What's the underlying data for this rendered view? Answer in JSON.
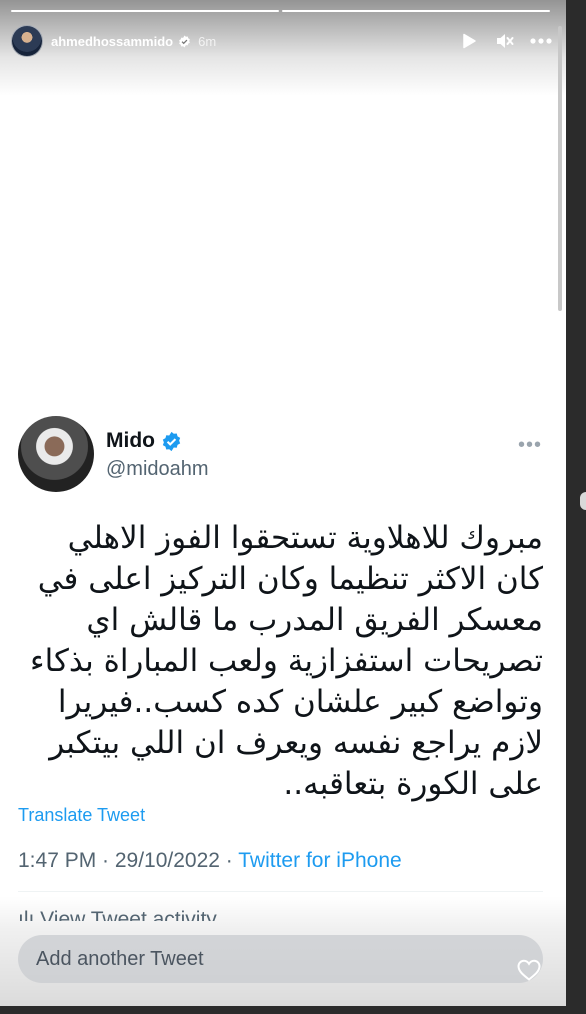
{
  "story": {
    "username": "ahmedhossammido",
    "time": "6m",
    "progress": [
      1.0,
      1.0
    ]
  },
  "tweet": {
    "name": "Mido",
    "handle": "@midoahm",
    "text": "مبروك للاهلاوية تستحقوا الفوز الاهلي كان الاكثر تنظيما وكان التركيز اعلى في معسكر الفريق المدرب ما قالش اي تصريحات استفزازية ولعب المباراة بذكاء وتواضع كبير علشان كده كسب..فيريرا لازم يراجع نفسه ويعرف ان اللي بيتكبر على الكورة بتعاقبه..",
    "translate": "Translate Tweet",
    "time": "1:47 PM · 29/10/2022 · ",
    "source": "Twitter for iPhone",
    "activity": "ılı View Tweet activity"
  },
  "reply": {
    "placeholder": "Add another Tweet"
  },
  "colors": {
    "accent": "#1d9bf0",
    "text": "#0f1419",
    "muted": "#536471"
  }
}
